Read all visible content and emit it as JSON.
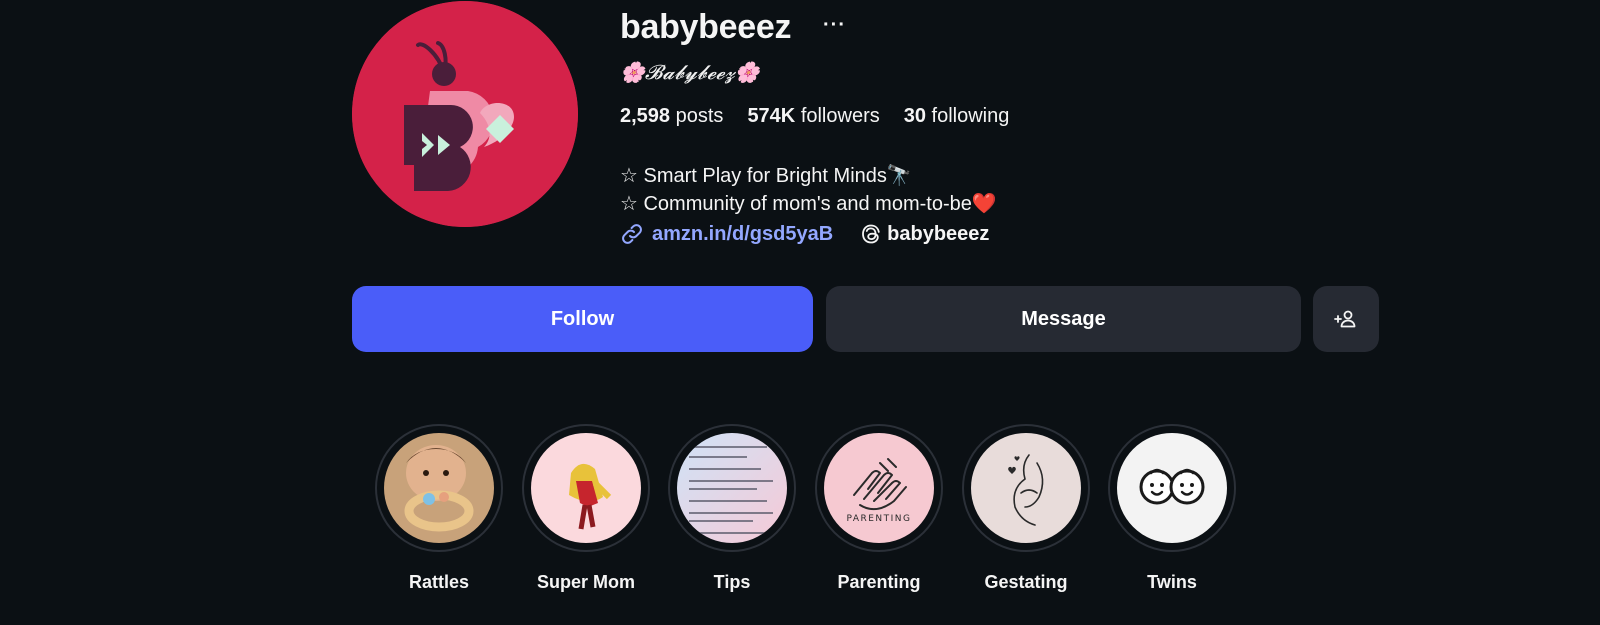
{
  "profile": {
    "username": "babybeeez",
    "more_label": "···",
    "full_name": "🌸𝓑𝓪𝓫𝔂𝓫𝓮𝓮𝔃🌸",
    "stats": {
      "posts_count": "2,598",
      "posts_label": "posts",
      "followers_count": "574K",
      "followers_label": "followers",
      "following_count": "30",
      "following_label": "following"
    },
    "bio": [
      "☆ Smart Play for Bright Minds🔭",
      "☆ Community of mom's and mom-to-be❤️"
    ],
    "link_text": "amzn.in/d/gsd5yaB",
    "threads_handle": "babybeeez"
  },
  "actions": {
    "follow_label": "Follow",
    "message_label": "Message"
  },
  "highlights": [
    {
      "label": "Rattles"
    },
    {
      "label": "Super Mom"
    },
    {
      "label": "Tips"
    },
    {
      "label": "Parenting",
      "image_text": "PARENTING"
    },
    {
      "label": "Gestating"
    },
    {
      "label": "Twins"
    }
  ],
  "colors": {
    "background": "#0b1014",
    "follow_button": "#4a5df9",
    "secondary_button": "#262a33",
    "link": "#93a7ff",
    "avatar_bg": "#d42249"
  }
}
